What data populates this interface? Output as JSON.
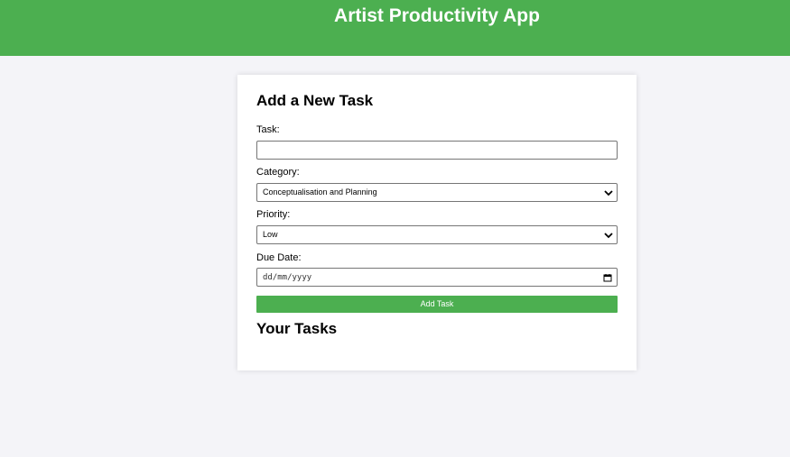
{
  "header": {
    "title": "Artist Productivity App",
    "color": "#4caf50"
  },
  "form": {
    "heading": "Add a New Task",
    "task_label": "Task:",
    "task_value": "",
    "category_label": "Category:",
    "category_value": "Conceptualisation and Planning",
    "priority_label": "Priority:",
    "priority_value": "Low",
    "due_date_label": "Due Date:",
    "due_date_placeholder": "dd/mm/yyyy",
    "submit_label": "Add Task"
  },
  "tasks": {
    "heading": "Your Tasks"
  },
  "icons": {
    "category_dropdown": "chevron-down-icon",
    "priority_dropdown": "chevron-down-icon",
    "date_picker": "calendar-icon"
  }
}
